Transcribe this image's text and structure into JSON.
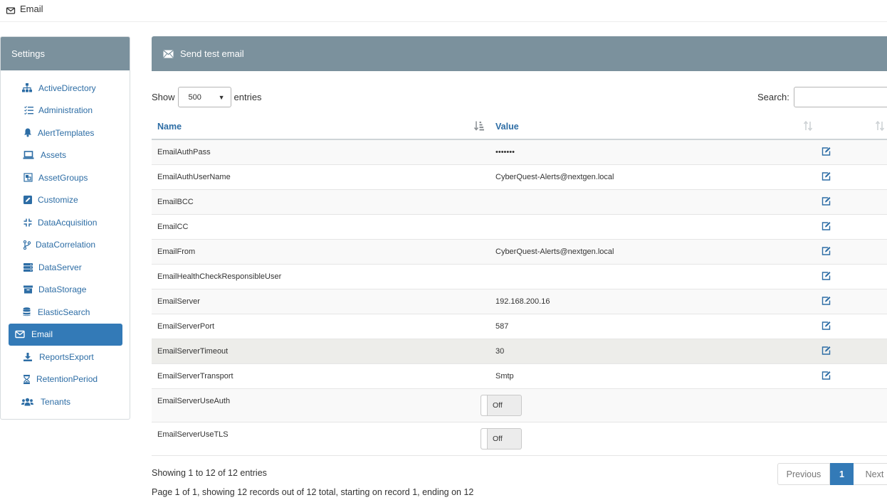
{
  "topbar": {
    "title": "Email",
    "icon": "envelope-icon"
  },
  "sidebar": {
    "header": "Settings",
    "items": [
      {
        "label": "ActiveDirectory",
        "icon": "sitemap-icon",
        "active": false
      },
      {
        "label": "Administration",
        "icon": "list-check-icon",
        "active": false
      },
      {
        "label": "AlertTemplates",
        "icon": "bell-icon",
        "active": false
      },
      {
        "label": "Assets",
        "icon": "laptop-icon",
        "active": false
      },
      {
        "label": "AssetGroups",
        "icon": "object-group-icon",
        "active": false
      },
      {
        "label": "Customize",
        "icon": "edit-square-icon",
        "active": false
      },
      {
        "label": "DataAcquisition",
        "icon": "compress-icon",
        "active": false
      },
      {
        "label": "DataCorrelation",
        "icon": "code-branch-icon",
        "active": false
      },
      {
        "label": "DataServer",
        "icon": "server-icon",
        "active": false
      },
      {
        "label": "DataStorage",
        "icon": "archive-icon",
        "active": false
      },
      {
        "label": "ElasticSearch",
        "icon": "database-icon",
        "active": false
      },
      {
        "label": "Email",
        "icon": "envelope-icon",
        "active": true
      },
      {
        "label": "ReportsExport",
        "icon": "download-icon",
        "active": false
      },
      {
        "label": "RetentionPeriod",
        "icon": "hourglass-icon",
        "active": false
      },
      {
        "label": "Tenants",
        "icon": "users-icon",
        "active": false
      }
    ]
  },
  "panel": {
    "title": "Send test email",
    "icon": "envelope-send-icon"
  },
  "controls": {
    "show_label": "Show",
    "entries_value": "500",
    "entries_label": "entries",
    "search_label": "Search:",
    "search_value": ""
  },
  "table": {
    "headers": {
      "name": "Name",
      "value": "Value"
    },
    "rows": [
      {
        "name": "EmailAuthPass",
        "value": "•••••••",
        "type": "text"
      },
      {
        "name": "EmailAuthUserName",
        "value": "CyberQuest-Alerts@nextgen.local",
        "type": "text"
      },
      {
        "name": "EmailBCC",
        "value": "",
        "type": "text"
      },
      {
        "name": "EmailCC",
        "value": "",
        "type": "text"
      },
      {
        "name": "EmailFrom",
        "value": "CyberQuest-Alerts@nextgen.local",
        "type": "text"
      },
      {
        "name": "EmailHealthCheckResponsibleUser",
        "value": "",
        "type": "text"
      },
      {
        "name": "EmailServer",
        "value": "192.168.200.16",
        "type": "text"
      },
      {
        "name": "EmailServerPort",
        "value": "587",
        "type": "text"
      },
      {
        "name": "EmailServerTimeout",
        "value": "30",
        "type": "text"
      },
      {
        "name": "EmailServerTransport",
        "value": "Smtp",
        "type": "text"
      },
      {
        "name": "EmailServerUseAuth",
        "value": "Off",
        "type": "toggle"
      },
      {
        "name": "EmailServerUseTLS",
        "value": "Off",
        "type": "toggle"
      }
    ]
  },
  "footer": {
    "info": "Showing 1 to 12 of 12 entries",
    "info2": "Page 1 of 1, showing 12 records out of 12 total, starting on record 1, ending on 12",
    "previous": "Previous",
    "page": "1",
    "next": "Next"
  },
  "colors": {
    "accent": "#337ab7",
    "header_bg": "#7b919d",
    "link": "#2d6da5"
  }
}
